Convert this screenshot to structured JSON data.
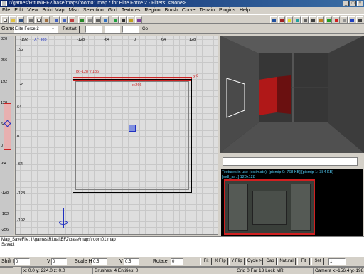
{
  "window": {
    "title": "I:/games/Ritual/EF2/base/maps/room01.map * for Elite Force 2 - Filters: <None>",
    "controls": [
      "_",
      "□",
      "x"
    ]
  },
  "menu": [
    "File",
    "Edit",
    "View",
    "Build Map",
    "Misc",
    "Selection",
    "Grid",
    "Textures",
    "Region",
    "Brush",
    "Curve",
    "Terrain",
    "Plugins",
    "Help"
  ],
  "gamebar": {
    "game_label": "Game",
    "game_value": "Elite Force 2",
    "restart_label": "Restart",
    "go_label": "Go"
  },
  "zruler": {
    "ticks": [
      "320",
      "256",
      "192",
      "128",
      "64",
      "0",
      "-64",
      "-128",
      "-192",
      "-256"
    ]
  },
  "grid": {
    "view_label": "XY Top",
    "top_ticks": [
      "-192",
      "-128",
      "-64",
      "0",
      "64",
      "128"
    ],
    "left_ticks": [
      "192",
      "128",
      "64",
      "0",
      "-64",
      "-128",
      "-192"
    ],
    "selection_coord": "(x:-128  y:136)",
    "width_label": "x:266",
    "side_label": "y:8"
  },
  "texture_panel": {
    "info": "Textures in use (estimate): [picmip 0: 768 KB]  [picmip 1: 384 KB]",
    "sub": "[mdl_ar...] 128x128"
  },
  "console": {
    "lines": [
      "Map_SaveFile: I:\\games\\Ritual\\EF2\\base\\maps\\room01.map",
      "Saved."
    ]
  },
  "surface": {
    "shift_h_label": "Shift H",
    "shift_h": "0",
    "v1_label": "V",
    "v1": "0",
    "scale_h_label": "Scale H",
    "scale_h": "0.5",
    "v2_label": "V",
    "v2": "0.5",
    "rotate_label": "Rotate",
    "rotate": "0",
    "buttons": [
      "Fit",
      "X Flip",
      "Y Flip",
      "Cycle >",
      "Cap",
      "Natural",
      "Fit",
      "Set"
    ],
    "fit_value": "1"
  },
  "status": {
    "coords": "x: 0.0  y: 224.0  z: 0.0",
    "counts": "Brushes: 4  Entities: 0",
    "grid": "Grid 0 Far 13 Lock MR",
    "camera": "Camera x:-156.4 y:-198.0 z:79.0"
  },
  "colors": {
    "title_bg": "#0a246a",
    "grid_bg": "#dedede",
    "selection": "#cc2222",
    "camera_bg": "#2a2a2a",
    "texture_text": "#50c8f0"
  },
  "icons": [
    "new-file-icon",
    "open-icon",
    "save-icon",
    "cut-icon",
    "copy-icon",
    "paste-icon",
    "flip-x-icon",
    "flip-y-icon",
    "rotate-icon",
    "select-icon",
    "clipper-icon",
    "csg-icon",
    "brush-icon",
    "texture-icon",
    "camera-icon",
    "lock-icon",
    "patch-icon"
  ]
}
